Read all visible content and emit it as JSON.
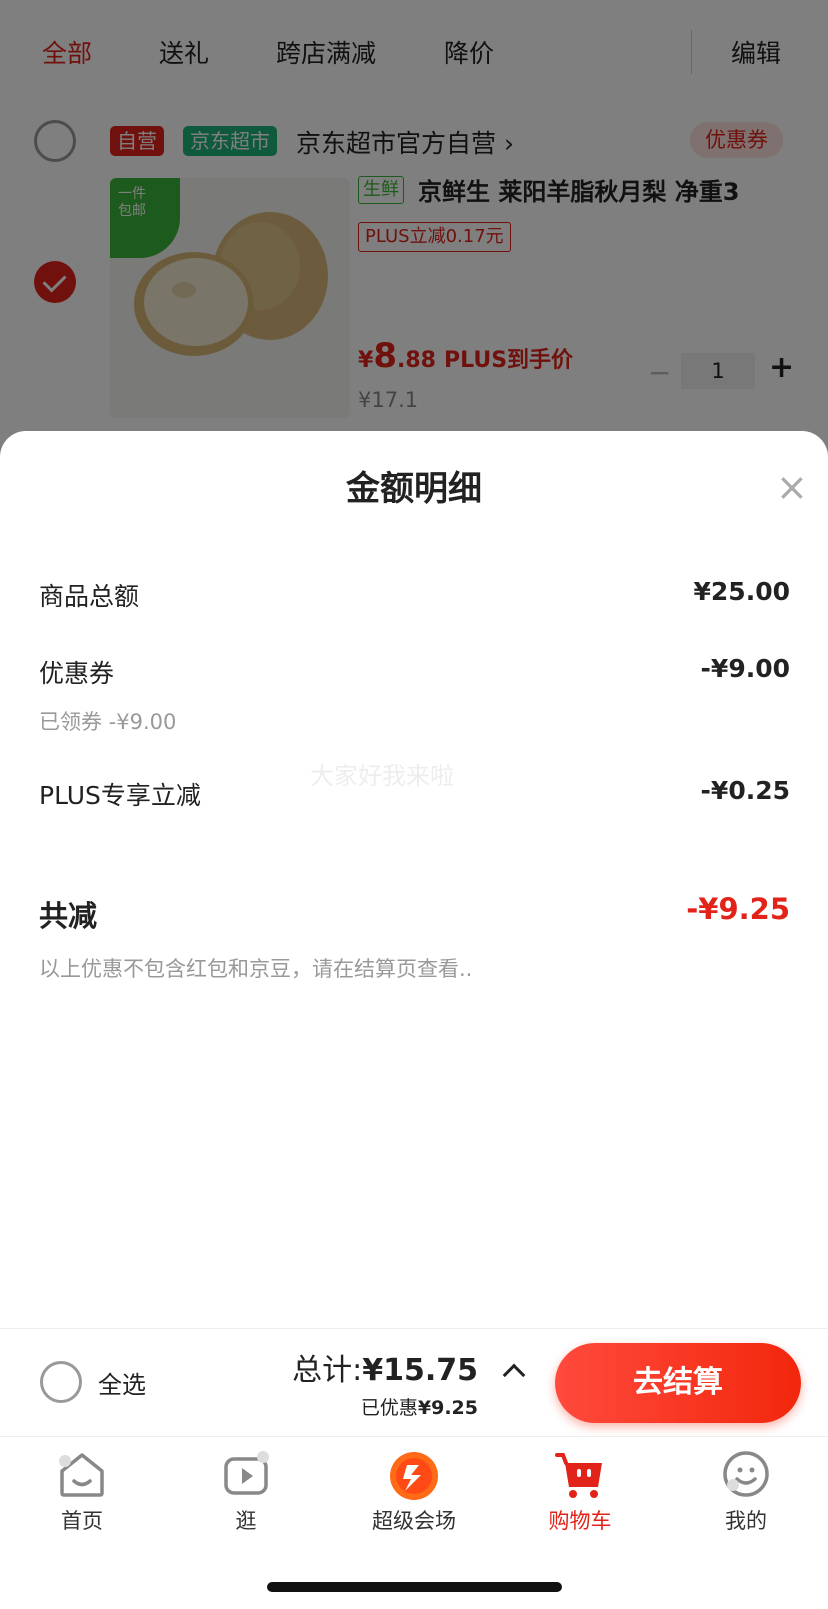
{
  "top_tabs": [
    {
      "label": "全部",
      "active": true
    },
    {
      "label": "送礼",
      "active": false
    },
    {
      "label": "跨店满减",
      "active": false
    },
    {
      "label": "降价",
      "active": false
    }
  ],
  "edit_label": "编辑",
  "shop": {
    "tag_self": "自营",
    "tag_market": "京东超市",
    "name": "京东超市官方自营 ›",
    "coupon_label": "优惠券"
  },
  "product": {
    "badge_line1": "一件",
    "badge_line2": "包邮",
    "fresh_tag": "生鲜",
    "title": "京鲜生 莱阳羊脂秋月梨 净重3",
    "plus_tag": "PLUS立减0.17元",
    "price_yuan": "¥",
    "price_int": "8",
    "price_dec": ".88",
    "price_label": "PLUS到手价",
    "orig_price": "¥17.1",
    "qty": "1",
    "qty_minus": "−",
    "qty_plus": "+"
  },
  "sheet": {
    "title": "金额明细",
    "close": "×",
    "rows": [
      {
        "label": "商品总额",
        "value": "¥25.00"
      },
      {
        "label": "优惠券",
        "value": "-¥9.00",
        "sub": "已领券 -¥9.00"
      },
      {
        "label": "PLUS专享立减",
        "value": "-¥0.25"
      }
    ],
    "total_label": "共减",
    "total_value": "-¥9.25",
    "note": "以上优惠不包含红包和京豆，请在结算页查看..",
    "watermark": "大家好我来啦"
  },
  "checkout": {
    "select_all": "全选",
    "total_prefix": "总计:",
    "total_amount": "¥15.75",
    "saved_prefix": "已优惠",
    "saved_amount": "¥9.25",
    "button": "去结算"
  },
  "nav": [
    {
      "label": "首页",
      "icon": "home-icon",
      "active": false
    },
    {
      "label": "逛",
      "icon": "video-icon",
      "active": false
    },
    {
      "label": "超级会场",
      "icon": "super-venue-icon",
      "active": false
    },
    {
      "label": "购物车",
      "icon": "cart-icon",
      "active": true
    },
    {
      "label": "我的",
      "icon": "profile-icon",
      "active": false
    }
  ],
  "colors": {
    "accent": "#e2231a",
    "green": "#3bb53b"
  }
}
